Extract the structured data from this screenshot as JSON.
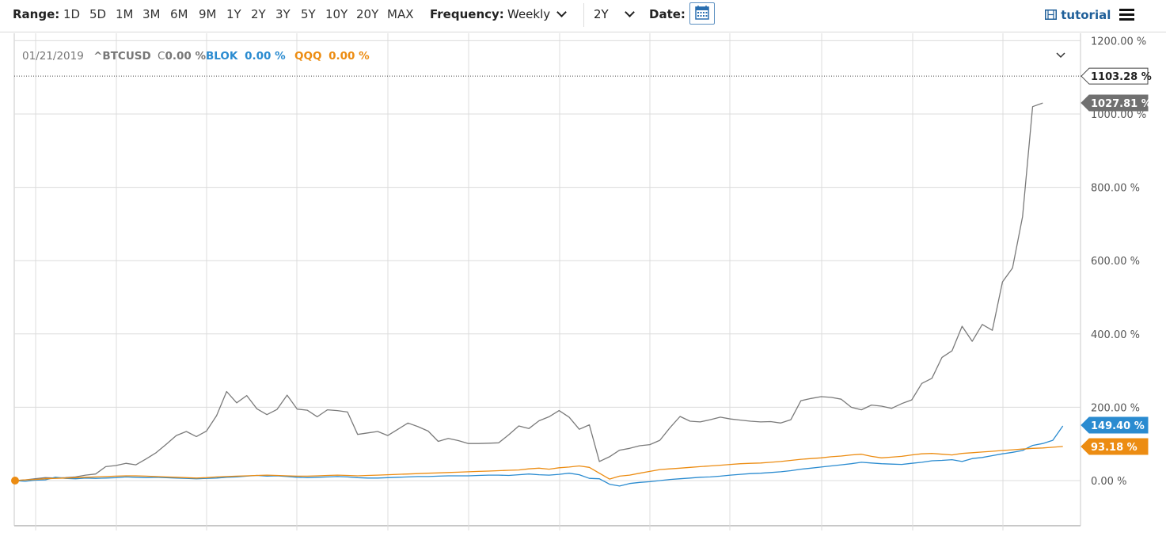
{
  "toolbar": {
    "range_label": "Range:",
    "ranges": [
      "1D",
      "5D",
      "1M",
      "3M",
      "6M",
      "9M",
      "1Y",
      "2Y",
      "3Y",
      "5Y",
      "10Y",
      "20Y",
      "MAX"
    ],
    "frequency_label": "Frequency:",
    "frequency_value": "Weekly",
    "period_value": "2Y",
    "date_label": "Date:",
    "tutorial_label": "tutorial"
  },
  "legend": {
    "date": "01/21/2019",
    "items": [
      {
        "symbol": "^BTCUSD",
        "prefix": "C",
        "value": "0.00 %",
        "color": "#777777"
      },
      {
        "symbol": "BLOK",
        "prefix": "",
        "value": "0.00 %",
        "color": "#2a8bd0"
      },
      {
        "symbol": "QQQ",
        "prefix": "",
        "value": "0.00 %",
        "color": "#ec8c12"
      }
    ]
  },
  "colors": {
    "btc": "#7a7a7a",
    "blok": "#2a8bd0",
    "qqq": "#ec8c12",
    "grid": "#dcdcdc"
  },
  "chart_data": {
    "type": "line",
    "yunit": "%",
    "ylim": [
      -120,
      1210
    ],
    "yticks": [
      {
        "v": 1200,
        "label": "1200.00 %"
      },
      {
        "v": 1000,
        "label": "1000.00 %"
      },
      {
        "v": 800,
        "label": "800.00 %"
      },
      {
        "v": 600,
        "label": "600.00 %"
      },
      {
        "v": 400,
        "label": "400.00 %"
      },
      {
        "v": 200,
        "label": "200.00 %"
      },
      {
        "v": 0,
        "label": "0.00 %"
      }
    ],
    "x_start": "01/21/2019",
    "frequency": "Weekly",
    "crosshair_value": {
      "v": 1103.28,
      "label": "1103.28 %"
    },
    "series": [
      {
        "name": "^BTCUSD",
        "color": "#7a7a7a",
        "last_label": "1027.81 %",
        "values": [
          0,
          2,
          5,
          8,
          7,
          8,
          10,
          15,
          18,
          38,
          41,
          47,
          43,
          59,
          76,
          99,
          123,
          134,
          120,
          135,
          177,
          243,
          212,
          232,
          196,
          180,
          194,
          233,
          195,
          192,
          174,
          193,
          191,
          187,
          126,
          130,
          134,
          123,
          140,
          157,
          147,
          135,
          107,
          115,
          109,
          101,
          101,
          102,
          103,
          125,
          149,
          142,
          163,
          174,
          191,
          173,
          140,
          152,
          52,
          65,
          83,
          88,
          95,
          98,
          110,
          144,
          175,
          162,
          160,
          166,
          173,
          168,
          165,
          162,
          160,
          161,
          157,
          166,
          218,
          224,
          229,
          227,
          222,
          200,
          193,
          206,
          203,
          197,
          210,
          220,
          265,
          279,
          336,
          354,
          421,
          380,
          426,
          410,
          542,
          580,
          720,
          1020,
          1030
        ]
      },
      {
        "name": "BLOK",
        "color": "#2a8bd0",
        "last_label": "149.40 %",
        "values": [
          0,
          -2,
          1,
          2,
          9,
          6,
          5,
          7,
          6,
          7,
          8,
          10,
          9,
          8,
          9,
          8,
          7,
          6,
          5,
          6,
          7,
          9,
          10,
          12,
          14,
          12,
          13,
          11,
          9,
          8,
          9,
          10,
          11,
          10,
          8,
          7,
          7,
          8,
          9,
          10,
          11,
          11,
          12,
          13,
          13,
          13,
          14,
          15,
          15,
          14,
          16,
          18,
          16,
          15,
          17,
          20,
          16,
          6,
          5,
          -10,
          -15,
          -8,
          -5,
          -3,
          0,
          3,
          5,
          7,
          9,
          10,
          12,
          15,
          17,
          19,
          20,
          22,
          24,
          27,
          31,
          34,
          37,
          40,
          43,
          46,
          50,
          48,
          46,
          45,
          44,
          47,
          50,
          54,
          55,
          57,
          52,
          60,
          63,
          68,
          73,
          77,
          82,
          96,
          101,
          110,
          149
        ]
      },
      {
        "name": "QQQ",
        "color": "#ec8c12",
        "last_label": "93.18 %",
        "values": [
          0,
          2,
          3,
          5,
          6,
          7,
          8,
          9,
          10,
          11,
          12,
          13,
          13,
          12,
          11,
          10,
          9,
          8,
          7,
          8,
          10,
          11,
          12,
          13,
          14,
          15,
          14,
          13,
          12,
          12,
          13,
          14,
          15,
          14,
          13,
          14,
          15,
          16,
          17,
          18,
          19,
          20,
          21,
          22,
          23,
          24,
          25,
          26,
          27,
          28,
          29,
          32,
          34,
          31,
          35,
          37,
          40,
          36,
          20,
          4,
          12,
          15,
          20,
          25,
          30,
          32,
          34,
          36,
          38,
          40,
          42,
          44,
          46,
          47,
          48,
          50,
          52,
          55,
          58,
          60,
          62,
          65,
          67,
          70,
          72,
          66,
          62,
          64,
          66,
          70,
          73,
          74,
          72,
          70,
          74,
          76,
          78,
          80,
          82,
          84,
          86,
          88,
          89,
          91,
          93
        ]
      }
    ]
  }
}
